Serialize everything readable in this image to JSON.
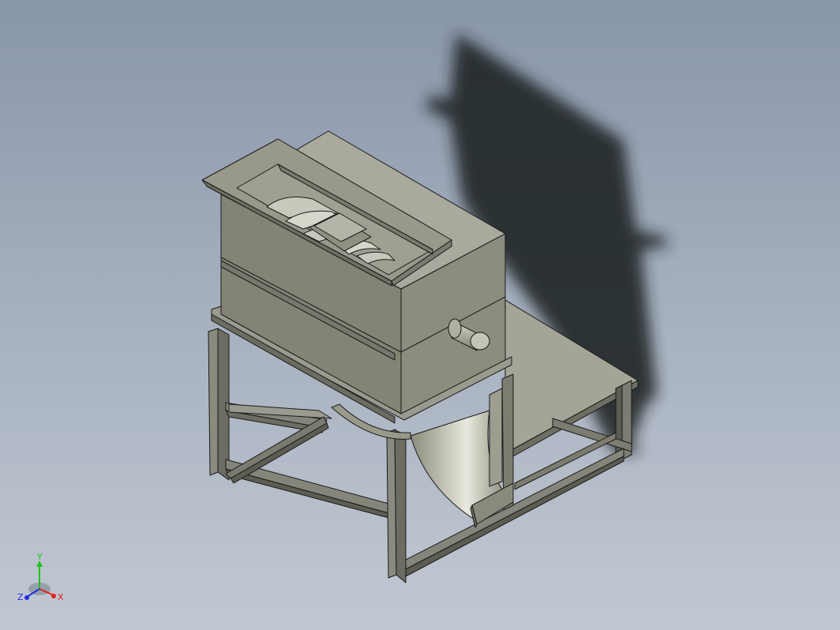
{
  "viewport": {
    "background_top": "#8996a9",
    "background_bottom": "#c2c8d2"
  },
  "model": {
    "part_color": "#8e8e80",
    "edge_color": "#1a1a1a",
    "shadow_color": "#1e2024"
  },
  "triad": {
    "x_label": "X",
    "y_label": "Y",
    "z_label": "Z",
    "x_color": "#e02020",
    "y_color": "#20c020",
    "z_color": "#2030e0"
  }
}
